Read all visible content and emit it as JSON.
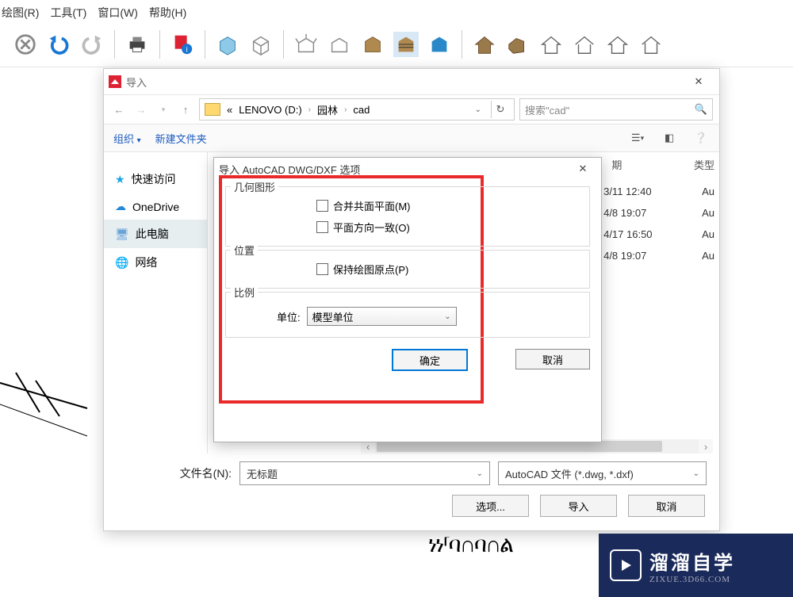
{
  "menubar": {
    "items": [
      "绘图(R)",
      "工具(T)",
      "窗口(W)",
      "帮助(H)"
    ]
  },
  "import_window": {
    "title": "导入",
    "nav": {
      "back": "←",
      "fwd": "→",
      "up": "↑"
    },
    "crumbs": {
      "root_prefix": "«",
      "drive": "LENOVO (D:)",
      "f1": "园林",
      "f2": "cad"
    },
    "search_placeholder": "搜索\"cad\"",
    "row2": {
      "org": "组织",
      "newfolder": "新建文件夹",
      "view_dd": "▾"
    },
    "sidebar": {
      "items": [
        {
          "icon": "★",
          "label": "快速访问"
        },
        {
          "icon": "☁",
          "label": "OneDrive"
        },
        {
          "icon": "🖥",
          "label": "此电脑"
        },
        {
          "icon": "🌐",
          "label": "网络"
        }
      ]
    },
    "columns": {
      "date": "期",
      "type": "类型"
    },
    "files": [
      {
        "partial_date": "3/11 12:40",
        "partial_type": "Au"
      },
      {
        "partial_date": "4/8 19:07",
        "partial_type": "Au"
      },
      {
        "partial_date": "4/17 16:50",
        "partial_type": "Au"
      },
      {
        "partial_date": "4/8 19:07",
        "partial_type": "Au"
      }
    ],
    "filename_label": "文件名(N):",
    "filename_value": "无标题",
    "filetype_value": "AutoCAD 文件 (*.dwg, *.dxf)",
    "buttons": {
      "options": "选项...",
      "import": "导入",
      "cancel": "取消"
    }
  },
  "options_modal": {
    "title": "导入 AutoCAD DWG/DXF 选项",
    "group_geometry": "几何图形",
    "chk_merge": "合并共面平面(M)",
    "chk_orient": "平面方向一致(O)",
    "group_position": "位置",
    "chk_origin": "保持绘图原点(P)",
    "group_scale": "比例",
    "unit_label": "单位:",
    "unit_value": "模型单位",
    "ok": "确定",
    "cancel": "取消"
  },
  "watermark": {
    "brand": "溜溜自学",
    "sub": "ZIXUE.3D66.COM"
  }
}
